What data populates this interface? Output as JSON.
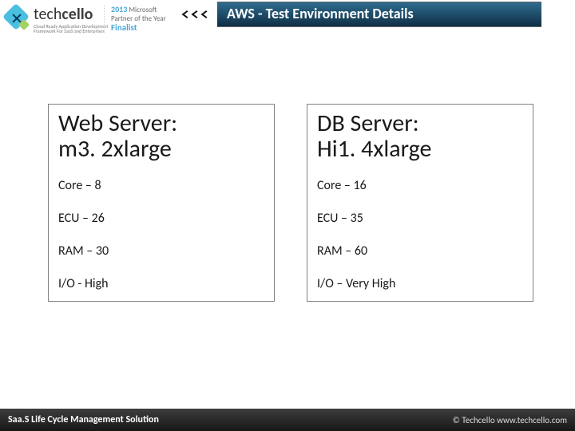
{
  "header": {
    "logo_word_plain": "tech",
    "logo_word_bold": "cello",
    "logo_tagline1": "Cloud Ready Application Development",
    "logo_tagline2": "Framework For SaaS and Enterprises",
    "partner_year": "2013",
    "partner_brand": "Microsoft",
    "partner_line1": "Partner of the Year",
    "partner_finalist": "Finalist"
  },
  "title": "AWS - Test Environment Details",
  "boxes": [
    {
      "title_l1": "Web Server:",
      "title_l2": "m3. 2xlarge",
      "rows": [
        "Core – 8",
        "ECU – 26",
        "RAM – 30",
        "I/O - High"
      ]
    },
    {
      "title_l1": "DB Server:",
      "title_l2": "Hi1. 4xlarge",
      "rows": [
        "Core – 16",
        "ECU – 35",
        "RAM – 60",
        "I/O – Very High"
      ]
    }
  ],
  "footer": {
    "left": "Saa.S Life Cycle Management Solution",
    "right": "© Techcello www.techcello.com"
  }
}
